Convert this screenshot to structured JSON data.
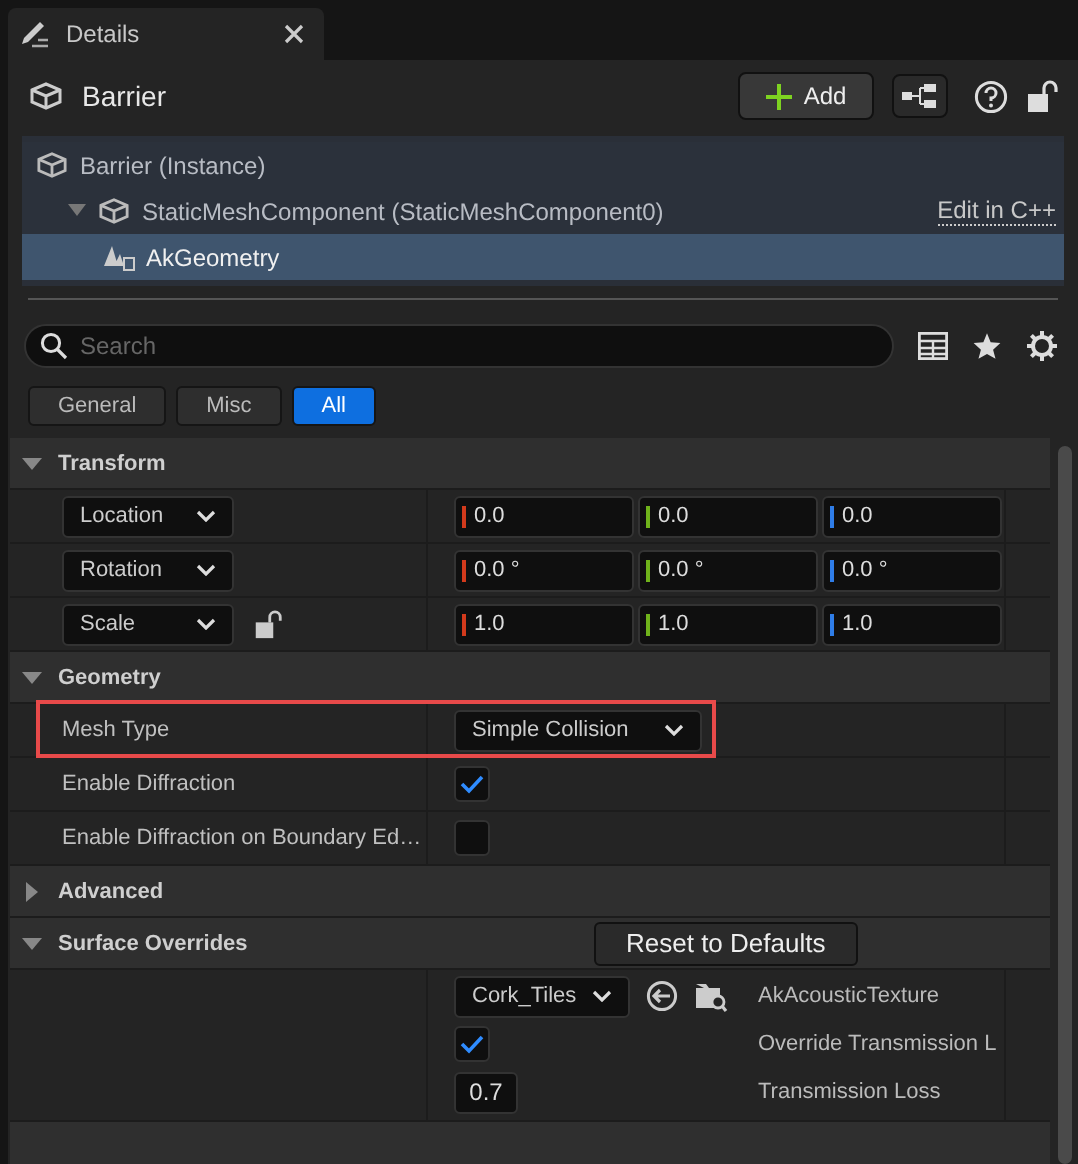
{
  "tab": {
    "title": "Details"
  },
  "header": {
    "title": "Barrier",
    "add_button": "Add"
  },
  "components": [
    {
      "label": "Barrier (Instance)",
      "selected": false,
      "children": [
        {
          "label": "StaticMeshComponent (StaticMeshComponent0)",
          "selected": false,
          "expanded": true,
          "link": "Edit in C++",
          "children": [
            {
              "label": "AkGeometry",
              "selected": true
            }
          ]
        }
      ]
    }
  ],
  "search": {
    "placeholder": "Search"
  },
  "filters": [
    {
      "label": "General",
      "selected": false
    },
    {
      "label": "Misc",
      "selected": false
    },
    {
      "label": "All",
      "selected": true
    }
  ],
  "sections": [
    {
      "title": "Transform",
      "expanded": true,
      "rows": [
        {
          "kind": "vector",
          "label": "Location",
          "values": [
            "0.0",
            "0.0",
            "0.0"
          ]
        },
        {
          "kind": "vector",
          "label": "Rotation",
          "values": [
            "0.0 °",
            "0.0 °",
            "0.0 °"
          ]
        },
        {
          "kind": "vector",
          "label": "Scale",
          "values": [
            "1.0",
            "1.0",
            "1.0"
          ],
          "lock": true
        }
      ]
    },
    {
      "title": "Geometry",
      "expanded": true,
      "rows": [
        {
          "kind": "dropdown",
          "label": "Mesh Type",
          "value": "Simple Collision",
          "highlighted": true
        },
        {
          "kind": "checkbox",
          "label": "Enable Diffraction",
          "checked": true
        },
        {
          "kind": "checkbox",
          "label": "Enable Diffraction on Boundary Ed…",
          "checked": false
        }
      ]
    },
    {
      "title": "Advanced",
      "expanded": false
    },
    {
      "title": "Surface Overrides",
      "expanded": true,
      "action": "Reset to Defaults",
      "rows": [
        {
          "kind": "surface",
          "texture": "Cork_Tiles",
          "texture_label": "AkAcousticTexture",
          "override_checked": true,
          "override_label": "Override Transmission L",
          "loss": "0.7",
          "loss_label": "Transmission Loss"
        }
      ]
    }
  ]
}
